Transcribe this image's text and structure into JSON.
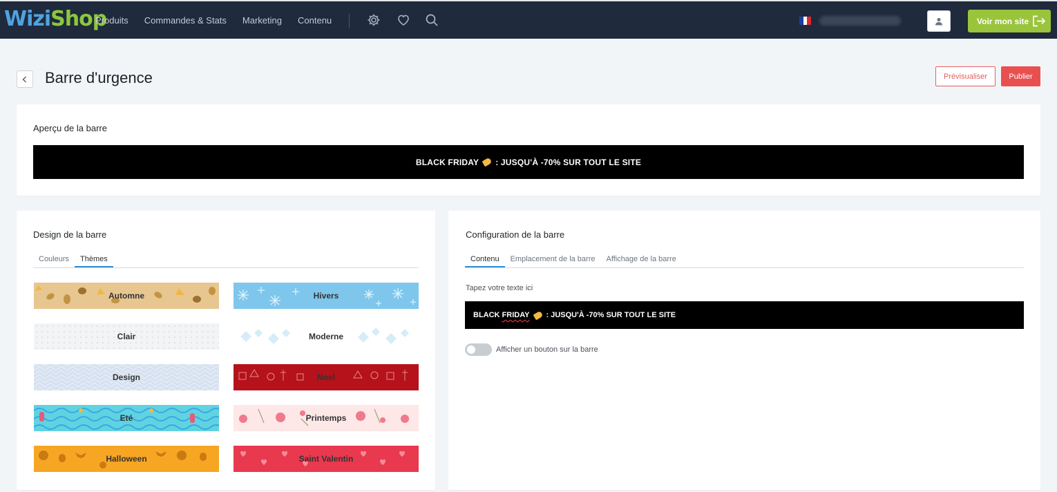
{
  "topbar": {
    "logo_part1": "Wizi",
    "logo_part2": "Shop",
    "nav": [
      "Produits",
      "Commandes & Stats",
      "Marketing",
      "Contenu"
    ],
    "site_button": "Voir mon site",
    "icons": [
      "gear-icon",
      "heart-icon",
      "search-icon",
      "user-icon",
      "exit-icon"
    ],
    "flag_colors": [
      "#1f3e9c",
      "#ffffff",
      "#e0262f"
    ]
  },
  "header": {
    "title": "Barre d'urgence",
    "preview_label": "Prévisualiser",
    "publish_label": "Publier"
  },
  "preview": {
    "title": "Aperçu de la barre",
    "text_before": "BLACK FRIDAY",
    "text_after": ": JUSQU'À -70% SUR TOUT LE SITE"
  },
  "design": {
    "title": "Design de la barre",
    "tabs": [
      "Couleurs",
      "Thèmes"
    ],
    "active_tab": "Thèmes",
    "themes": [
      {
        "name": "Automne",
        "color": "#e8c690"
      },
      {
        "name": "Hivers",
        "color": "#7ec6ec"
      },
      {
        "name": "Clair",
        "color": "#f2f4f6"
      },
      {
        "name": "Moderne",
        "color": "#ffffff"
      },
      {
        "name": "Design",
        "color": "#dfe8f4"
      },
      {
        "name": "Noel",
        "color": "#b5121b"
      },
      {
        "name": "Eté",
        "color": "#5fd3e0"
      },
      {
        "name": "Printemps",
        "color": "#fde7e7"
      },
      {
        "name": "Halloween",
        "color": "#f6a623"
      },
      {
        "name": "Saint Valentin",
        "color": "#e8394f"
      }
    ]
  },
  "config": {
    "title": "Configuration de la barre",
    "tabs": [
      "Contenu",
      "Emplacement de la barre",
      "Affichage de la barre"
    ],
    "active_tab": "Contenu",
    "input_label": "Tapez votre texte ici",
    "text_part1": "BLACK ",
    "text_part2": "FRIDAY",
    "text_part3": ": JUSQU'À -70% SUR TOUT LE SITE",
    "toggle_label": "Afficher un bouton sur la barre",
    "toggle_on": false
  }
}
